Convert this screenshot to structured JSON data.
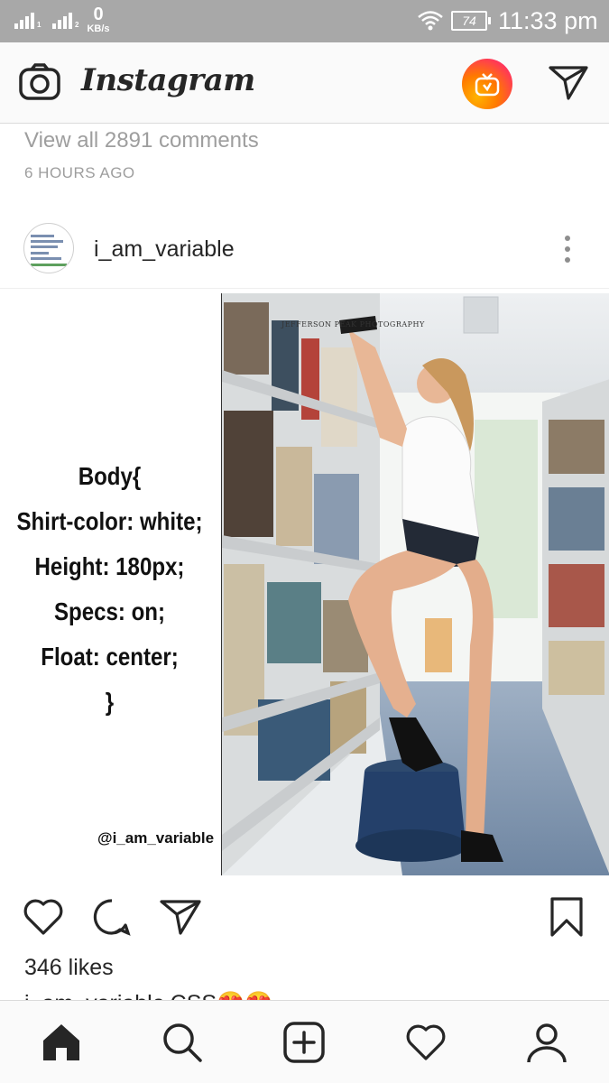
{
  "status_bar": {
    "net_speed_value": "0",
    "net_speed_unit": "KB/s",
    "sim1_label": "1",
    "sim2_label": "2",
    "battery": "74",
    "time": "11:33 pm"
  },
  "header": {
    "logo": "Instagram",
    "icons": [
      "camera-icon",
      "igtv-icon",
      "direct-send-icon"
    ]
  },
  "previous_post": {
    "view_comments": "View all 2891 comments",
    "time_ago": "6 HOURS AGO"
  },
  "post": {
    "username": "i_am_variable",
    "image_text": {
      "lines": [
        "Body{",
        "Shirt-color: white;",
        "Height: 180px;",
        "Specs: on;",
        "Float: center;",
        "}"
      ],
      "watermark": "@i_am_variable",
      "photo_credit": "JEFFERSON PEAK PHOTOGRAPHY"
    },
    "likes": "346 likes",
    "caption_user": "i_am_variable",
    "caption_text": "CSS😍😍"
  },
  "bottom_nav": {
    "items": [
      "home-icon",
      "search-icon",
      "new-post-icon",
      "activity-heart-icon",
      "profile-icon"
    ]
  },
  "colors": {
    "status_bar": "#a8a8a8",
    "secondary_text": "#9e9e9e",
    "primary_text": "#262626",
    "igtv_gradient": [
      "#ffb400",
      "#ff7a00",
      "#e0187c"
    ]
  }
}
